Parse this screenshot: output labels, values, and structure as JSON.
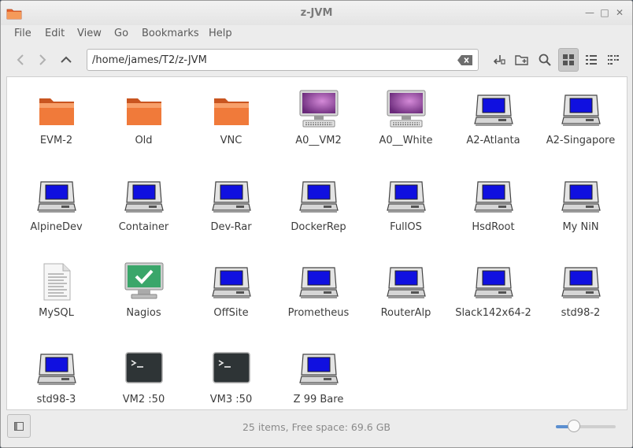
{
  "window": {
    "title": "z-JVM"
  },
  "menubar": {
    "items": [
      "File",
      "Edit",
      "View",
      "Go",
      "Bookmarks",
      "Help"
    ]
  },
  "toolbar": {
    "location": "/home/james/T2/z-JVM"
  },
  "items": [
    {
      "label": "EVM-2",
      "icon": "folder"
    },
    {
      "label": "Old",
      "icon": "folder"
    },
    {
      "label": "VNC",
      "icon": "folder"
    },
    {
      "label": "A0__VM2",
      "icon": "monitor-purple"
    },
    {
      "label": "A0__White",
      "icon": "monitor-purple"
    },
    {
      "label": "A2-Atlanta",
      "icon": "computer"
    },
    {
      "label": "A2-Singapore",
      "icon": "computer"
    },
    {
      "label": "AlpineDev",
      "icon": "computer"
    },
    {
      "label": "Container",
      "icon": "computer"
    },
    {
      "label": "Dev-Rar",
      "icon": "computer"
    },
    {
      "label": "DockerRep",
      "icon": "computer"
    },
    {
      "label": "FullOS",
      "icon": "computer"
    },
    {
      "label": "HsdRoot",
      "icon": "computer"
    },
    {
      "label": "My NiN",
      "icon": "computer"
    },
    {
      "label": "MySQL",
      "icon": "document"
    },
    {
      "label": "Nagios",
      "icon": "monitor-check"
    },
    {
      "label": "OffSite",
      "icon": "computer"
    },
    {
      "label": "Prometheus",
      "icon": "computer"
    },
    {
      "label": "RouterAlp",
      "icon": "computer"
    },
    {
      "label": "Slack142x64-2",
      "icon": "computer"
    },
    {
      "label": "std98-2",
      "icon": "computer"
    },
    {
      "label": "std98-3",
      "icon": "computer"
    },
    {
      "label": "VM2 :50",
      "icon": "terminal"
    },
    {
      "label": "VM3 :50",
      "icon": "terminal"
    },
    {
      "label": "Z 99 Bare",
      "icon": "computer"
    }
  ],
  "statusbar": {
    "text": "25 items, Free space: 69.6 GB",
    "zoom_level": 0.3
  },
  "colors": {
    "folder": "#f07a3a",
    "computer_screen": "#1010e0",
    "accent": "#5b8fd0"
  }
}
